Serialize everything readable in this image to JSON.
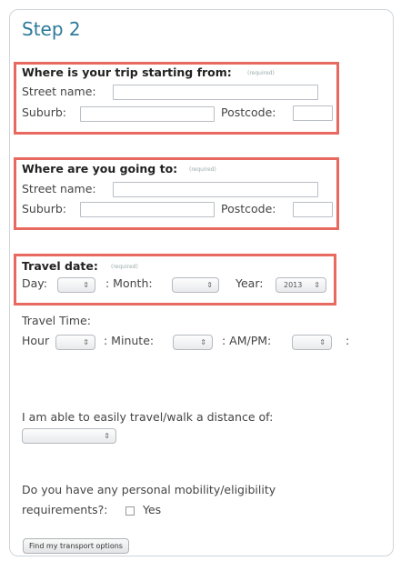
{
  "step_title": "Step 2",
  "required_note": "(required)",
  "start": {
    "heading": "Where is your trip starting from:",
    "street_label": "Street name:",
    "street_value": "",
    "suburb_label": "Suburb:",
    "suburb_value": "",
    "postcode_label": "Postcode:",
    "postcode_value": ""
  },
  "destination": {
    "heading": "Where are you going to:",
    "street_label": "Street name:",
    "street_value": "",
    "suburb_label": "Suburb:",
    "suburb_value": "",
    "postcode_label": "Postcode:",
    "postcode_value": ""
  },
  "travel_date": {
    "heading": "Travel date:",
    "day_label": "Day:",
    "day_value": "",
    "month_label": ": Month:",
    "month_value": "",
    "year_label": "Year:",
    "year_value": "2013"
  },
  "travel_time": {
    "heading": "Travel Time:",
    "hour_label": "Hour",
    "hour_value": "",
    "minute_label": ": Minute:",
    "minute_value": "",
    "ampm_label": ": AM/PM:",
    "ampm_value": "",
    "trailing_colon": ":"
  },
  "distance": {
    "label": "I am able to easily travel/walk a distance of:",
    "value": ""
  },
  "mobility": {
    "label_line1": "Do you have any personal mobility/eligibility",
    "label_line2": "requirements?:",
    "yes_label": "Yes"
  },
  "submit_label": "Find my transport options",
  "colors": {
    "title": "#2c7a9a",
    "highlight": "#e8695f",
    "border": "#cfd5da"
  },
  "icons": {
    "select_arrow": "up-down-arrows-icon"
  }
}
